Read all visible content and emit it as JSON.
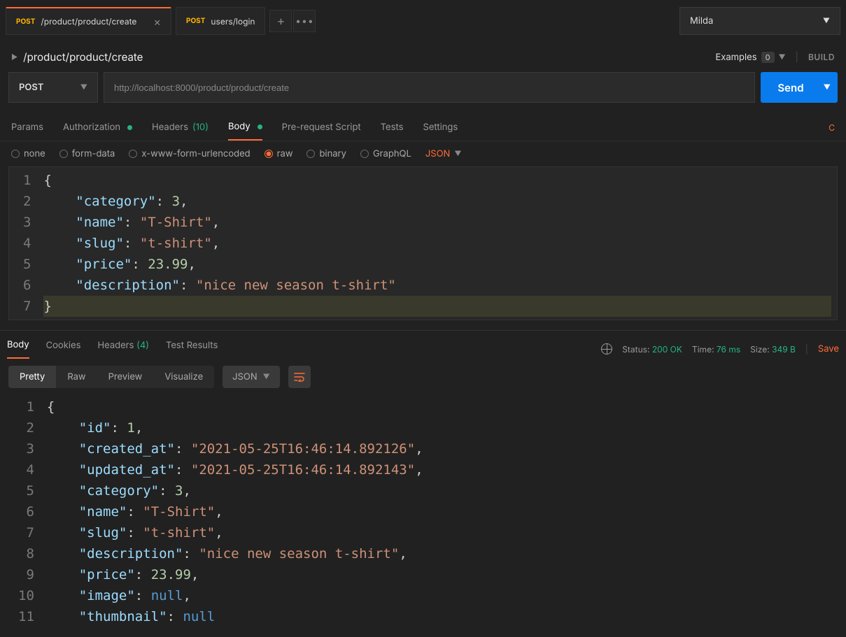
{
  "tabs": [
    {
      "method": "POST",
      "label": "/product/product/create",
      "active": true
    },
    {
      "method": "POST",
      "label": "users/login",
      "active": false
    }
  ],
  "environment": "Milda",
  "breadcrumb": {
    "title": "/product/product/create"
  },
  "examples": {
    "label": "Examples",
    "count": "0"
  },
  "build_label": "BUILD",
  "request": {
    "method": "POST",
    "url": "http://localhost:8000/product/product/create",
    "send_label": "Send"
  },
  "req_tabs": {
    "params": "Params",
    "authorization": "Authorization",
    "headers": "Headers",
    "headers_count": "(10)",
    "body": "Body",
    "prerequest": "Pre-request Script",
    "tests": "Tests",
    "settings": "Settings"
  },
  "body_types": {
    "none": "none",
    "formdata": "form-data",
    "xwww": "x-www-form-urlencoded",
    "raw": "raw",
    "binary": "binary",
    "graphql": "GraphQL",
    "json": "JSON"
  },
  "request_body_lines": [
    "{",
    "    \"category\": 3,",
    "    \"name\": \"T-Shirt\",",
    "    \"slug\": \"t-shirt\",",
    "    \"price\": 23.99,",
    "    \"description\": \"nice new season t-shirt\"",
    "}"
  ],
  "request_body_data": {
    "category": 3,
    "name": "T-Shirt",
    "slug": "t-shirt",
    "price": 23.99,
    "description": "nice new season t-shirt"
  },
  "response_tabs": {
    "body": "Body",
    "cookies": "Cookies",
    "headers": "Headers",
    "headers_count": "(4)",
    "test_results": "Test Results"
  },
  "response_meta": {
    "status_label": "Status:",
    "status_value": "200 OK",
    "time_label": "Time:",
    "time_value": "76 ms",
    "size_label": "Size:",
    "size_value": "349 B",
    "save": "Save"
  },
  "view_modes": {
    "pretty": "Pretty",
    "raw": "Raw",
    "preview": "Preview",
    "visualize": "Visualize",
    "json": "JSON"
  },
  "response_body_data": {
    "id": 1,
    "created_at": "2021-05-25T16:46:14.892126",
    "updated_at": "2021-05-25T16:46:14.892143",
    "category": 3,
    "name": "T-Shirt",
    "slug": "t-shirt",
    "description": "nice new season t-shirt",
    "price": 23.99,
    "image": null,
    "thumbnail": null
  }
}
